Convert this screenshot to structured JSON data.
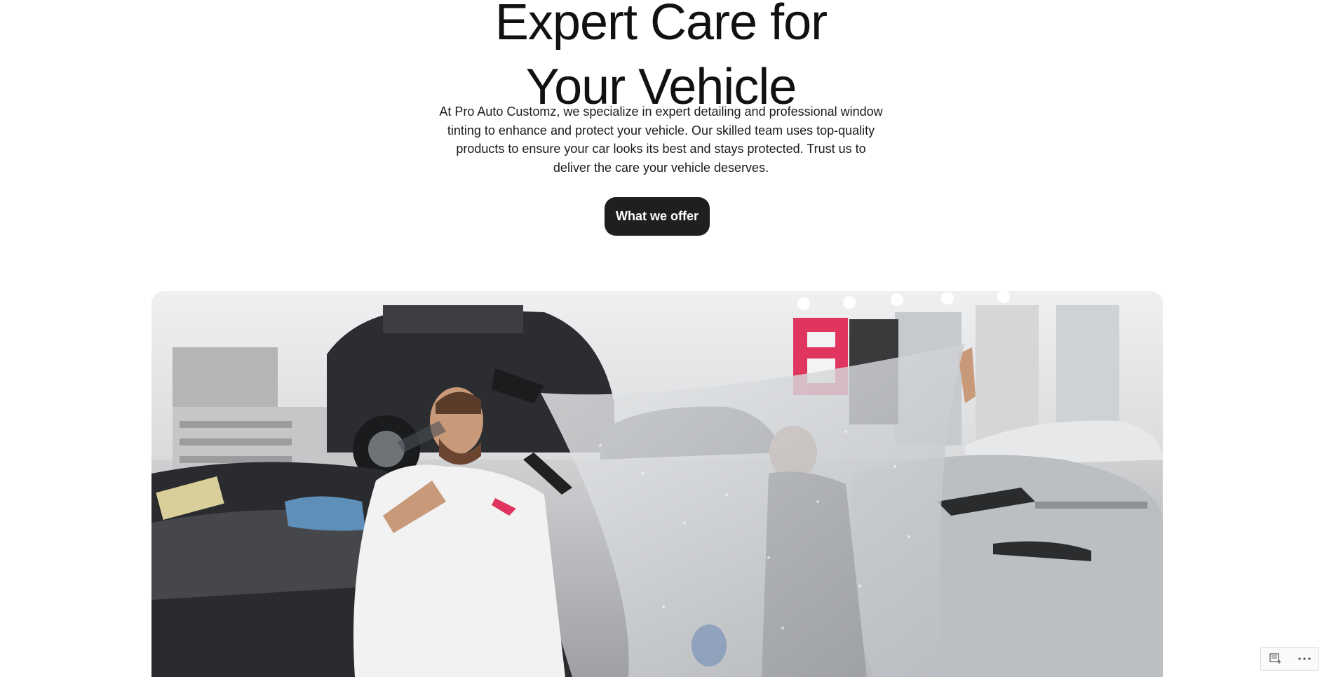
{
  "hero": {
    "title_line1": "Expert Care for",
    "title_line2": "Your Vehicle",
    "description": "At Pro Auto Customz, we specialize in expert detailing and professional window tinting to enhance and protect your vehicle. Our skilled team uses top-quality products to ensure your car looks its best and stays protected. Trust us to deliver the care your vehicle deserves.",
    "cta_label": "What we offer",
    "image_alt": "Technicians applying protective film to a car inside a detailing garage"
  },
  "toolbar": {
    "icons": [
      "notes-add-icon",
      "more-options-icon"
    ]
  },
  "colors": {
    "button_bg": "#1f1f1f",
    "button_text": "#ffffff",
    "text": "#111111",
    "accent_sign": "#e0355e"
  }
}
